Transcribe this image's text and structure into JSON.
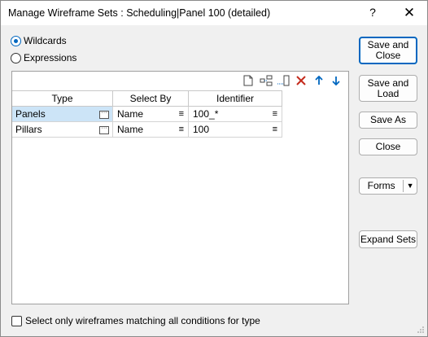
{
  "window": {
    "title": "Manage Wireframe Sets : Scheduling|Panel 100 (detailed)",
    "help": "?",
    "close": "✕"
  },
  "mode": {
    "wildcards": "Wildcards",
    "expressions": "Expressions",
    "selected": "wildcards"
  },
  "grid": {
    "columns": [
      "Type",
      "Select By",
      "Identifier"
    ],
    "rows": [
      {
        "type": "Panels",
        "select_by": "Name",
        "identifier": "100_*"
      },
      {
        "type": "Pillars",
        "select_by": "Name",
        "identifier": "100"
      }
    ]
  },
  "option": {
    "label": "Select only wireframes matching all conditions for type",
    "checked": false
  },
  "buttons": {
    "save_and_close_1": "Save and",
    "save_and_close_2": "Close",
    "save_and_load_1": "Save and",
    "save_and_load_2": "Load",
    "save_as": "Save As",
    "close": "Close",
    "forms": "Forms",
    "expand_sets": "Expand Sets"
  },
  "colors": {
    "accent": "#0067c0",
    "selection": "#cce4f7",
    "delete": "#c42b1c"
  }
}
